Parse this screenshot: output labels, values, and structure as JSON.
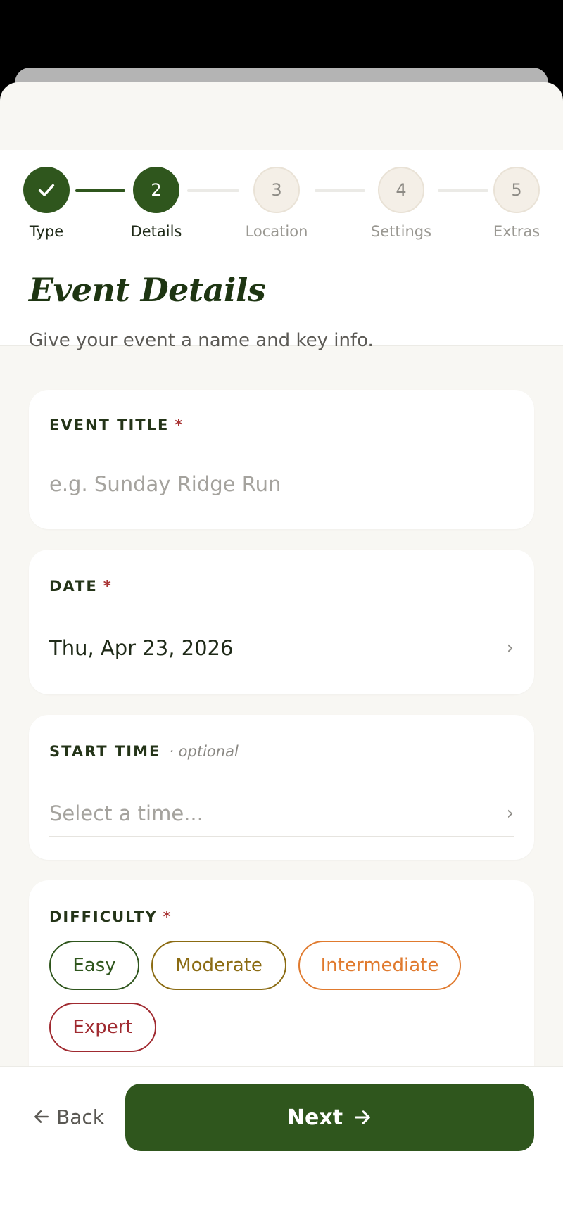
{
  "colors": {
    "primary": "#2f561d",
    "required": "#a83232",
    "easy": "#2f561d",
    "moderate": "#8b6b12",
    "intermediate": "#e07a2e",
    "expert": "#a02a30"
  },
  "stepper": {
    "steps": [
      {
        "label": "Type",
        "number": "",
        "state": "done",
        "icon": "check-icon"
      },
      {
        "label": "Details",
        "number": "2",
        "state": "active"
      },
      {
        "label": "Location",
        "number": "3",
        "state": "todo"
      },
      {
        "label": "Settings",
        "number": "4",
        "state": "todo"
      },
      {
        "label": "Extras",
        "number": "5",
        "state": "todo"
      }
    ]
  },
  "header": {
    "title": "Event Details",
    "subtitle": "Give your event a name and key info."
  },
  "fields": {
    "event_title": {
      "label": "EVENT TITLE",
      "required": "*",
      "value": "",
      "placeholder": "e.g. Sunday Ridge Run"
    },
    "date": {
      "label": "DATE",
      "required": "*",
      "value": "Thu, Apr 23, 2026",
      "chevron": "›"
    },
    "start_time": {
      "label": "START TIME",
      "optional": "· optional",
      "placeholder": "Select a time...",
      "chevron": "›"
    },
    "difficulty": {
      "label": "DIFFICULTY",
      "required": "*",
      "options": [
        "Easy",
        "Moderate",
        "Intermediate",
        "Expert"
      ]
    }
  },
  "footer": {
    "back_label": "Back",
    "back_icon": "arrow-left-icon",
    "next_label": "Next",
    "next_icon": "arrow-right-icon"
  }
}
